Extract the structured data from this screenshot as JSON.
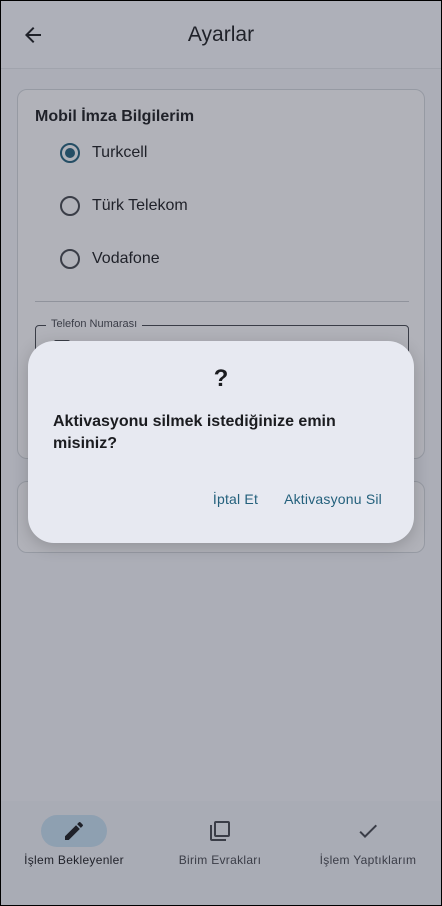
{
  "appbar": {
    "title": "Ayarlar",
    "back_icon": "arrow-left-icon"
  },
  "signature_card": {
    "title": "Mobil İmza Bilgilerim",
    "operators": [
      {
        "label": "Turkcell",
        "selected": true
      },
      {
        "label": "Türk Telekom",
        "selected": false
      },
      {
        "label": "Vodafone",
        "selected": false
      }
    ],
    "phone_field": {
      "label": "Telefon Numarası"
    }
  },
  "dialog": {
    "icon": "?",
    "message": "Aktivasyonu silmek istediğinize emin misiniz?",
    "cancel_label": "İptal Et",
    "confirm_label": "Aktivasyonu Sil"
  },
  "bottom_nav": {
    "items": [
      {
        "label": "İşlem Bekleyenler",
        "icon": "pencil-icon",
        "active": true
      },
      {
        "label": "Birim Evrakları",
        "icon": "copy-icon",
        "active": false
      },
      {
        "label": "İşlem Yaptıklarım",
        "icon": "check-icon",
        "active": false
      }
    ]
  },
  "colors": {
    "accent": "#23607c",
    "nav_pill": "#c3dcee",
    "dialog_bg": "#e7e9f1"
  }
}
